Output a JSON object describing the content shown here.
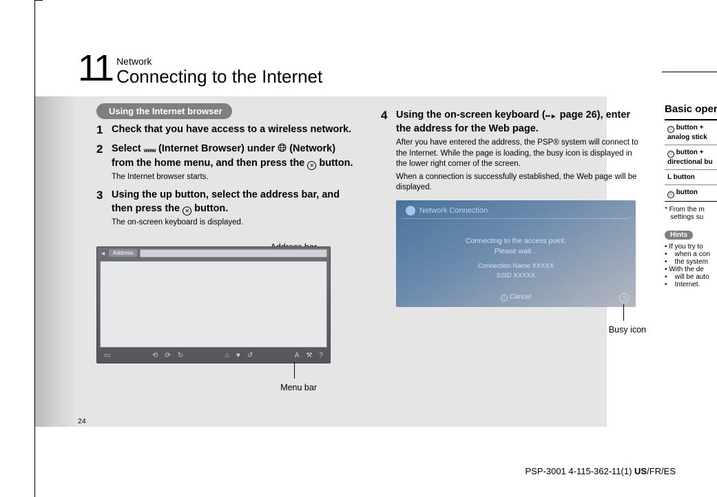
{
  "chapter": {
    "number": "11",
    "category": "Network",
    "title": "Connecting to the Internet"
  },
  "section_tag": "Using the Internet browser",
  "steps": {
    "s1": {
      "num": "1",
      "title": "Check that you have access to a wireless network."
    },
    "s2": {
      "num": "2",
      "title_a": "Select ",
      "title_b": " (Internet Browser) under ",
      "title_c": " (Network) from the home menu, and then press the ",
      "title_d": " button.",
      "sub": "The Internet browser starts."
    },
    "s3": {
      "num": "3",
      "title_a": "Using the up button, select the address bar, and then press the ",
      "title_b": " button.",
      "sub": "The on-screen keyboard is displayed."
    },
    "s4": {
      "num": "4",
      "title_a": "Using the on-screen keyboard (",
      "title_b": " page 26), enter the address for the Web page.",
      "sub1": "After you have entered the address, the PSP® system will connect to the Internet. While the page is loading, the busy icon is displayed in the lower right corner of the screen.",
      "sub2": "When a connection is successfully established, the Web page will be displayed."
    }
  },
  "fig_browser": {
    "addr_label": "Address bar",
    "menu_label": "Menu bar",
    "addr_pill": "Address"
  },
  "fig_conn": {
    "header": "Network Connection",
    "line1": "Connecting to the access point.",
    "line2": "Please wait...",
    "detail1": "Connection Name   XXXXX",
    "detail2": "SSID   XXXXX",
    "cancel": "Cancel",
    "busy_label": "Busy icon"
  },
  "far": {
    "heading": "Basic opera",
    "rows": [
      " button +\nanalog stick",
      " button +\ndirectional bu",
      "L button",
      " button"
    ],
    "row_sym": [
      "□",
      "□",
      "",
      "△"
    ],
    "note1": "*  From the m",
    "note2": "settings su",
    "hints_label": "Hints",
    "bullets": [
      "If you try to",
      "when a con",
      "the system",
      "With the de",
      "will be auto",
      "Internet."
    ]
  },
  "page_number": "24",
  "footer": {
    "model": "PSP-3001 4-115-362-11(1) ",
    "lang_bold": "US",
    "lang_rest": "/FR/ES"
  }
}
